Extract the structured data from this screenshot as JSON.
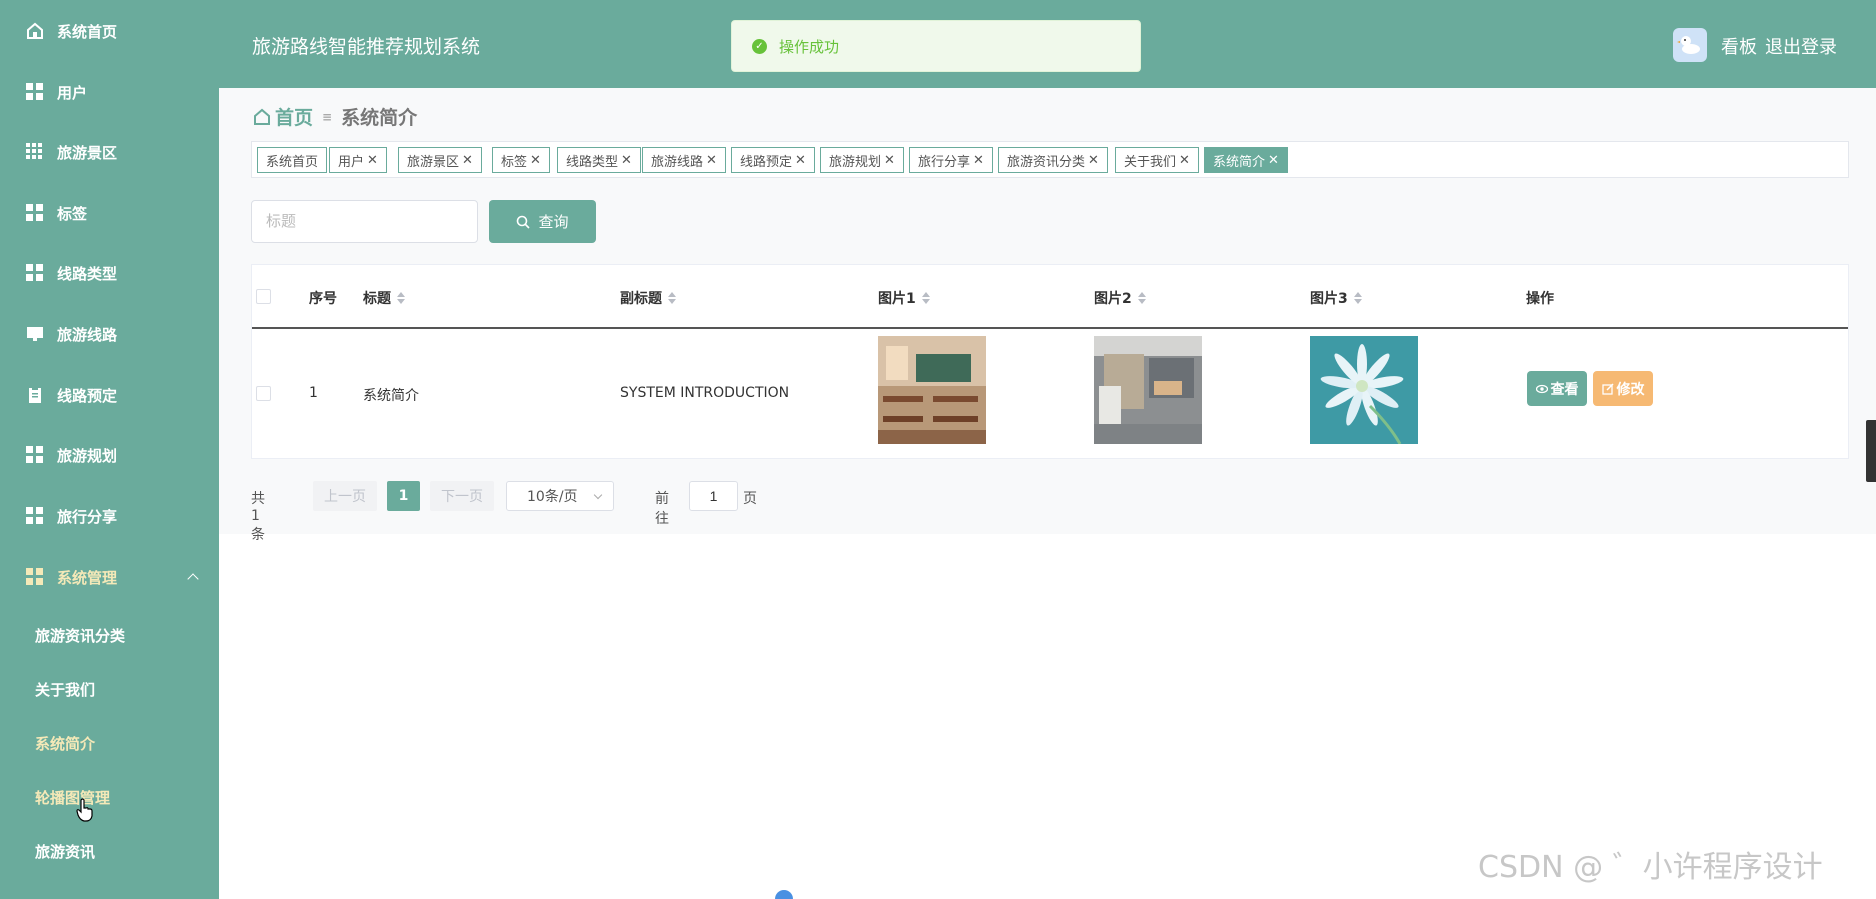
{
  "sidebar": {
    "items": [
      {
        "label": "系统首页",
        "icon": "home-icon"
      },
      {
        "label": "用户",
        "icon": "grid-icon"
      },
      {
        "label": "旅游景区",
        "icon": "grid-nine-icon"
      },
      {
        "label": "标签",
        "icon": "grid-icon"
      },
      {
        "label": "线路类型",
        "icon": "grid-icon"
      },
      {
        "label": "旅游线路",
        "icon": "monitor-icon"
      },
      {
        "label": "线路预定",
        "icon": "clipboard-icon"
      },
      {
        "label": "旅游规划",
        "icon": "grid-icon"
      },
      {
        "label": "旅行分享",
        "icon": "grid-icon"
      },
      {
        "label": "系统管理",
        "icon": "grid-icon"
      }
    ],
    "subitems": [
      {
        "label": "旅游资讯分类"
      },
      {
        "label": "关于我们"
      },
      {
        "label": "系统简介"
      },
      {
        "label": "轮播图管理"
      },
      {
        "label": "旅游资讯"
      }
    ]
  },
  "header": {
    "title": "旅游路线智能推荐规划系统",
    "dashboard": "看板",
    "logout": "退出登录"
  },
  "toast": {
    "message": "操作成功"
  },
  "breadcrumb": {
    "home": "首页",
    "current": "系统简介"
  },
  "tags": [
    {
      "label": "系统首页",
      "closable": false
    },
    {
      "label": "用户",
      "closable": true
    },
    {
      "label": "旅游景区",
      "closable": true
    },
    {
      "label": "标签",
      "closable": true
    },
    {
      "label": "线路类型",
      "closable": true
    },
    {
      "label": "旅游线路",
      "closable": true
    },
    {
      "label": "线路预定",
      "closable": true
    },
    {
      "label": "旅游规划",
      "closable": true
    },
    {
      "label": "旅行分享",
      "closable": true
    },
    {
      "label": "旅游资讯分类",
      "closable": true
    },
    {
      "label": "关于我们",
      "closable": true
    },
    {
      "label": "系统简介",
      "closable": true,
      "active": true
    }
  ],
  "search": {
    "placeholder": "标题",
    "button": "查询"
  },
  "table": {
    "headers": {
      "index": "序号",
      "title": "标题",
      "subtitle": "副标题",
      "pic1": "图片1",
      "pic2": "图片2",
      "pic3": "图片3",
      "actions": "操作"
    },
    "rows": [
      {
        "index": "1",
        "title": "系统简介",
        "subtitle": "SYSTEM INTRODUCTION",
        "view": "查看",
        "edit": "修改"
      }
    ]
  },
  "pagination": {
    "total": "共 1 条",
    "prev": "上一页",
    "current": "1",
    "next": "下一页",
    "page_size": "10条/页",
    "goto": "前往",
    "goto_value": "1",
    "page_unit": "页"
  },
  "watermark": "CSDN @ ゛小许程序设计",
  "colors": {
    "primary": "#6aab9c",
    "warning": "#f6b973",
    "success": "#67c23a"
  }
}
